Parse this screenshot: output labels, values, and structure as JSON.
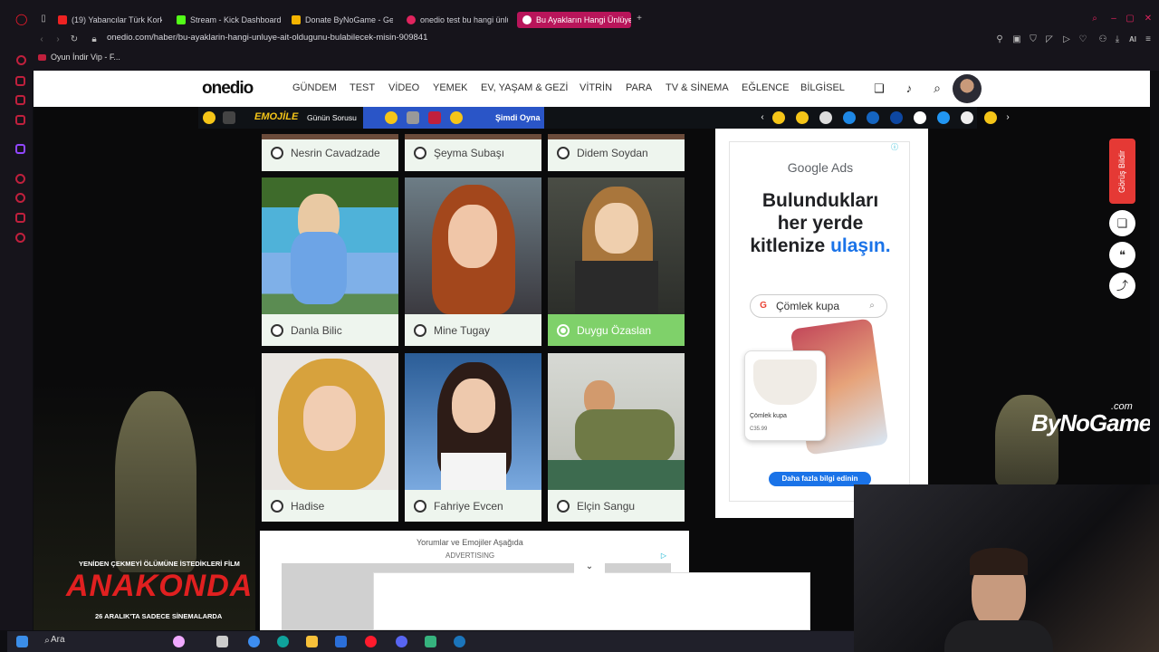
{
  "browser": {
    "tabs": [
      {
        "label": "(19) Yabancılar Türk Korku",
        "color": "#e22"
      },
      {
        "label": "Stream - Kick Dashboard",
        "color": "#53fc18"
      },
      {
        "label": "Donate ByNoGame - Gele",
        "color": "#f5b400"
      },
      {
        "label": "onedio test bu hangi ünlü",
        "color": "#e0245e"
      },
      {
        "label": "Bu Ayakların Hangi Ünlüye",
        "color": "#e0245e"
      }
    ],
    "url": "onedio.com/haber/bu-ayaklarin-hangi-unluye-ait-oldugunu-bulabilecek-misin-909841",
    "bookmark": "Oyun İndir Vip - F...",
    "profile_badge": "AI"
  },
  "site": {
    "logo": "onedio",
    "nav": [
      "GÜNDEM",
      "TEST",
      "VİDEO",
      "YEMEK",
      "EV, YAŞAM & GEZİ",
      "VİTRİN",
      "PARA",
      "TV & SİNEMA",
      "EĞLENCE",
      "BİLGİSEL"
    ],
    "emoji_bar": {
      "brand": "EMOJİLE",
      "daily": "Günün Sorusu",
      "play": "Şimdi Oyna"
    }
  },
  "quiz": {
    "top_row": [
      "Nesrin Cavadzade",
      "Şeyma Subaşı",
      "Didem Soydan"
    ],
    "options": [
      {
        "name": "Danla Bilic",
        "selected": false
      },
      {
        "name": "Mine Tugay",
        "selected": false
      },
      {
        "name": "Duygu Özaslan",
        "selected": true
      },
      {
        "name": "Hadise",
        "selected": false
      },
      {
        "name": "Fahriye Evcen",
        "selected": false
      },
      {
        "name": "Elçin Sangu",
        "selected": false
      }
    ],
    "comments_link": "Yorumlar ve Emojiler Aşağıda",
    "advertising": "ADVERTISING"
  },
  "ad": {
    "brand": "Google Ads",
    "headline_line1": "Bulundukları",
    "headline_line2": "her yerde",
    "headline_line3a": "kitlenize ",
    "headline_line3b": "ulaşın.",
    "search_text": "Çömlek kupa",
    "product": "Çömlek kupa",
    "price": "C35.99",
    "cta": "Daha fazla bilgi edinin"
  },
  "side_tools": {
    "feedback": "Görüş Bildir"
  },
  "overlays": {
    "movie_tagline": "YENİDEN ÇEKMEYİ ÖLÜMÜNE İSTEDİKLERİ FİLM",
    "movie_title": "ANAKONDA",
    "movie_date": "26 ARALIK'TA SADECE SİNEMALARDA",
    "stream_brand": "ByNoGame",
    "stream_domain": ".com"
  },
  "taskbar": {
    "search": "Ara"
  }
}
